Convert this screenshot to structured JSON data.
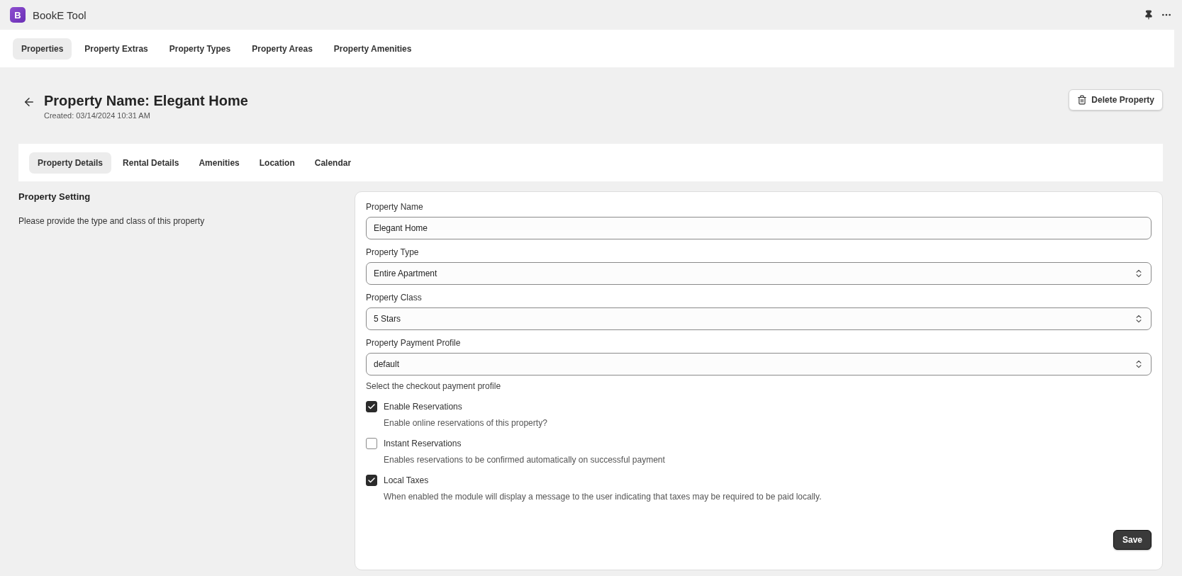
{
  "app": {
    "logo_letter": "B",
    "title": "BookE Tool"
  },
  "top_tabs": [
    {
      "label": "Properties",
      "selected": true
    },
    {
      "label": "Property Extras",
      "selected": false
    },
    {
      "label": "Property Types",
      "selected": false
    },
    {
      "label": "Property Areas",
      "selected": false
    },
    {
      "label": "Property Amenities",
      "selected": false
    }
  ],
  "header": {
    "title": "Property Name: Elegant Home",
    "created": "Created: 03/14/2024 10:31 AM",
    "delete_button": "Delete Property"
  },
  "detail_tabs": [
    {
      "label": "Property Details",
      "selected": true
    },
    {
      "label": "Rental Details",
      "selected": false
    },
    {
      "label": "Amenities",
      "selected": false
    },
    {
      "label": "Location",
      "selected": false
    },
    {
      "label": "Calendar",
      "selected": false
    }
  ],
  "section": {
    "title": "Property Setting",
    "description": "Please provide the type and class of this property"
  },
  "fields": [
    {
      "kind": "text",
      "label": "Property Name",
      "value": "Elegant Home"
    },
    {
      "kind": "select",
      "label": "Property Type",
      "value": "Entire Apartment"
    },
    {
      "kind": "select",
      "label": "Property Class",
      "value": "5 Stars"
    },
    {
      "kind": "select",
      "label": "Property Payment Profile",
      "value": "default",
      "help": "Select the checkout payment profile"
    }
  ],
  "options": [
    {
      "label": "Enable Reservations",
      "description": "Enable online reservations of this property?",
      "checked": true
    },
    {
      "label": "Instant Reservations",
      "description": "Enables reservations to be confirmed automatically on successful payment",
      "checked": false
    },
    {
      "label": "Local Taxes",
      "description": "When enabled the module will display a message to the user indicating that taxes may be required to be paid locally.",
      "checked": true
    }
  ],
  "save_button": "Save"
}
